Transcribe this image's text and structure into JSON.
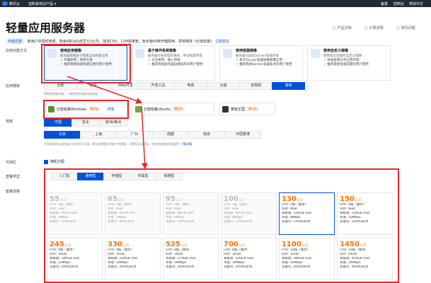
{
  "topbar": {
    "brand": "腾讯云",
    "menu": "选购其他云产品 ▾",
    "right": [
      "备案",
      "控制台",
      "简体中文"
    ]
  },
  "page": {
    "title": "轻量应用服务器",
    "links": [
      "产品文档",
      "计费说明",
      "常见问题"
    ]
  },
  "promo": {
    "tag": "专属优惠",
    "text": "新用户享限时特惠，熟睿4核16G低至32元/月，独享CPU，12M高带宽，免安装60种开箱即用，即刻畅享《幻兽帕鲁》",
    "link": "立即前往"
  },
  "labels": {
    "create": "应用创建方式",
    "template": "应用模板",
    "region": "地域",
    "zone": "可用区",
    "plantype": "套餐类型",
    "plan": "套餐规格"
  },
  "create_cards": [
    {
      "title": "使用应用镜像",
      "desc": "服务器搭载基于镜像自动构建应用",
      "b1": "✓ 开箱即用，简单方便",
      "b2": "✓ 推荐需要快速构建应用的用户使用",
      "selected": true
    },
    {
      "title": "基于操作系统镜像",
      "desc": "服务器仅安装操作系统，手动搭建环境",
      "b1": "✓ 灵活易用，随心所欲",
      "b2": "✓ 推荐熟悉服务器运维操作的用户使用",
      "selected": false
    },
    {
      "title": "使用容器镜像",
      "desc": "服务器已安装Docker容器环境",
      "b1": "✓ 基于Docker容器镜像部署应用",
      "b2": "✓ 推荐熟悉Docker容器技术的用户使用",
      "selected": false
    },
    {
      "title": "使用自定义镜像",
      "desc": "使用您已创建的自定义镜像",
      "b1": "✓ 快速复制已有应用环境",
      "b2": "✓ 推荐需要批量部署的用户使用",
      "selected": false
    }
  ],
  "template_tabs": [
    "全部",
    "网站",
    "Web开发",
    "开发工具",
    "电商",
    "云盘",
    "音视频",
    "游戏"
  ],
  "template_active": 7,
  "template_note": "预装游戏服务端，一键搭建专属游戏服务器",
  "images": [
    {
      "name": "幻兽帕鲁Windows",
      "badge": "腾讯云",
      "detail": "详情",
      "color": "#5b8f2e"
    },
    {
      "name": "幻兽帕鲁Ubuntu",
      "badge": "腾讯云",
      "color": "#7aa53a"
    },
    {
      "name": "雾锁王国",
      "badge": "腾讯云",
      "color": "#333333"
    }
  ],
  "region_tabs": [
    "中国",
    "亚太",
    "欧洲/美洲"
  ],
  "region_cities": [
    "北京",
    "上海",
    "广州",
    "成都",
    "南京",
    "中国香港"
  ],
  "region_note": "不同地域的云服务器之间内网不互通，建议选择靠近您客户的地域，可降低访问时延。境外地域使用时需遵守",
  "region_link": "了解详情",
  "zone_option": "随机分配",
  "plan_tabs": [
    "入门型",
    "通用型",
    "存储型",
    "专属型",
    "锐驰型"
  ],
  "plan_active": 1,
  "plans": [
    {
      "price": "55",
      "unit": "元/月",
      "cpu": "CPU: 2核（独享）",
      "mem": "内存: 2GB",
      "disk": "系统盘: 40GB SSD",
      "bw": "带宽: 4Mbps",
      "flow": "流量包: 500GB/月",
      "on": false
    },
    {
      "price": "65",
      "unit": "元/月",
      "cpu": "CPU: 2核（独享）",
      "mem": "内存: 4GB",
      "disk": "系统盘: 60GB SSD",
      "bw": "带宽: 5Mbps",
      "flow": "流量包: 800GB/月",
      "on": false
    },
    {
      "price": "95",
      "unit": "元/月",
      "cpu": "CPU: 2核（独享）",
      "mem": "内存: 4GB",
      "disk": "系统盘: 80GB SSD",
      "bw": "带宽: 6Mbps",
      "flow": "流量包: 1000GB/月",
      "on": false
    },
    {
      "price": "100",
      "unit": "元/月",
      "cpu": "CPU: 2核（独享）",
      "mem": "内存: 8GB",
      "disk": "系统盘: 80GB SSD",
      "bw": "带宽: 8Mbps",
      "flow": "流量包: 1200GB/月",
      "on": false
    },
    {
      "price": "130",
      "unit": "元/月",
      "cpu": "CPU: 2核（独享）",
      "mem": "内存: 8GB",
      "disk": "系统盘: 100GB SSD",
      "bw": "带宽: 8Mbps",
      "flow": "流量包: 1200GB/月",
      "on": true
    },
    {
      "price": "150",
      "unit": "元/月",
      "cpu": "CPU: 4核（独享）",
      "mem": "内存: 8GB",
      "disk": "系统盘: 120GB SSD",
      "bw": "带宽: 10Mbps",
      "flow": "流量包: 1500GB/月",
      "on": true
    },
    {
      "price": "245",
      "unit": "元/月",
      "cpu": "CPU: 4核（独享）",
      "mem": "内存: 16GB",
      "disk": "系统盘: 180GB SSD",
      "bw": "带宽: 12Mbps",
      "flow": "流量包: 2000GB/月",
      "on": true
    },
    {
      "price": "330",
      "unit": "元/月",
      "cpu": "CPU: 4核（独享）",
      "mem": "内存: 16GB",
      "disk": "系统盘: 220GB SSD",
      "bw": "带宽: 14Mbps",
      "flow": "流量包: 2500GB/月",
      "on": true
    },
    {
      "price": "525",
      "unit": "元/月",
      "cpu": "CPU: 8核（独享）",
      "mem": "内存: 16GB",
      "disk": "系统盘: 270GB SSD",
      "bw": "带宽: 16Mbps",
      "flow": "流量包: 3000GB/月",
      "on": true
    },
    {
      "price": "700",
      "unit": "元/月",
      "cpu": "CPU: 8核（独享）",
      "mem": "内存: 32GB",
      "disk": "系统盘: 320GB SSD",
      "bw": "带宽: 18Mbps",
      "flow": "流量包: 3500GB/月",
      "on": true
    },
    {
      "price": "1100",
      "unit": "元/月",
      "cpu": "CPU: 16核（独享）",
      "mem": "内存: 32GB",
      "disk": "系统盘: 380GB SSD",
      "bw": "带宽: 20Mbps",
      "flow": "流量包: 4000GB/月",
      "on": true
    },
    {
      "price": "1450",
      "unit": "元/月",
      "cpu": "CPU: 16核（独享）",
      "mem": "内存: 64GB",
      "disk": "系统盘: 450GB SSD",
      "bw": "带宽: 24Mbps",
      "flow": "流量包: 5000GB/月",
      "on": true
    }
  ],
  "colors": {
    "accent": "#0052d9",
    "price": "#ff7200",
    "highlight": "#e6262c"
  }
}
